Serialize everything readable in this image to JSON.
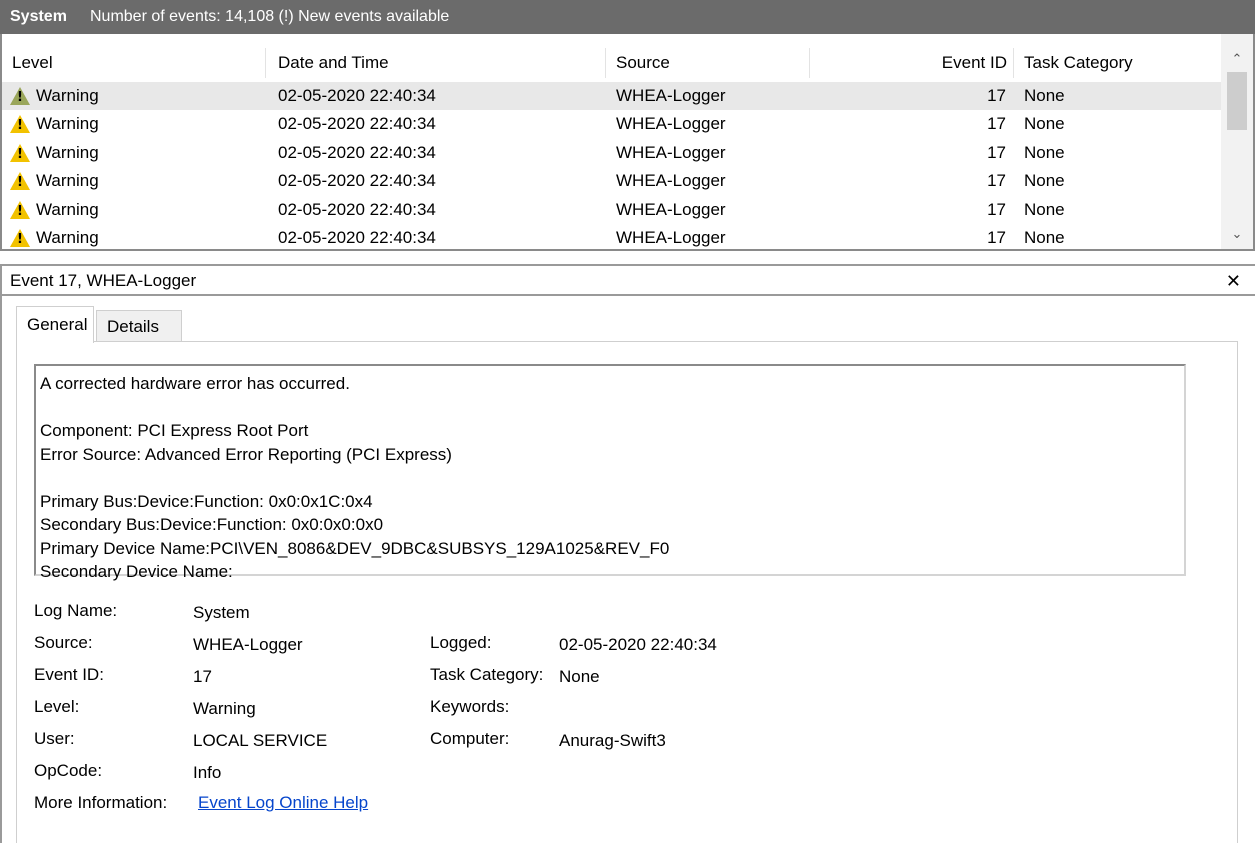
{
  "header": {
    "title": "System",
    "summary": "Number of events: 14,108 (!) New events available"
  },
  "columns": [
    "Level",
    "Date and Time",
    "Source",
    "Event ID",
    "Task Category"
  ],
  "events": [
    {
      "level": "Warning",
      "datetime": "02-05-2020 22:40:34",
      "source": "WHEA-Logger",
      "event_id": "17",
      "task_category": "None"
    },
    {
      "level": "Warning",
      "datetime": "02-05-2020 22:40:34",
      "source": "WHEA-Logger",
      "event_id": "17",
      "task_category": "None"
    },
    {
      "level": "Warning",
      "datetime": "02-05-2020 22:40:34",
      "source": "WHEA-Logger",
      "event_id": "17",
      "task_category": "None"
    },
    {
      "level": "Warning",
      "datetime": "02-05-2020 22:40:34",
      "source": "WHEA-Logger",
      "event_id": "17",
      "task_category": "None"
    },
    {
      "level": "Warning",
      "datetime": "02-05-2020 22:40:34",
      "source": "WHEA-Logger",
      "event_id": "17",
      "task_category": "None"
    },
    {
      "level": "Warning",
      "datetime": "02-05-2020 22:40:34",
      "source": "WHEA-Logger",
      "event_id": "17",
      "task_category": "None"
    }
  ],
  "detail": {
    "title": "Event 17, WHEA-Logger",
    "close_icon": "close-icon",
    "tabs": [
      "General",
      "Details"
    ],
    "description": [
      "A corrected hardware error has occurred.",
      "",
      "Component: PCI Express Root Port",
      "Error Source: Advanced Error Reporting (PCI Express)",
      "",
      "Primary Bus:Device:Function: 0x0:0x1C:0x4",
      "Secondary Bus:Device:Function: 0x0:0x0:0x0",
      "Primary Device Name:PCI\\VEN_8086&DEV_9DBC&SUBSYS_129A1025&REV_F0",
      "Secondary Device Name:"
    ],
    "props": {
      "log_name_label": "Log Name:",
      "log_name": "System",
      "source_label": "Source:",
      "source": "WHEA-Logger",
      "logged_label": "Logged:",
      "logged": "02-05-2020 22:40:34",
      "event_id_label": "Event ID:",
      "event_id": "17",
      "task_category_label": "Task Category:",
      "task_category": "None",
      "level_label": "Level:",
      "level": "Warning",
      "keywords_label": "Keywords:",
      "keywords": "",
      "user_label": "User:",
      "user": "LOCAL SERVICE",
      "computer_label": "Computer:",
      "computer": "Anurag-Swift3",
      "opcode_label": "OpCode:",
      "opcode": "Info",
      "more_info_label": "More Information:",
      "more_info_link": "Event Log Online Help"
    }
  },
  "icons": {
    "warning": "warning-icon",
    "scroll_up": "chevron-up-icon",
    "scroll_down": "chevron-down-icon"
  }
}
